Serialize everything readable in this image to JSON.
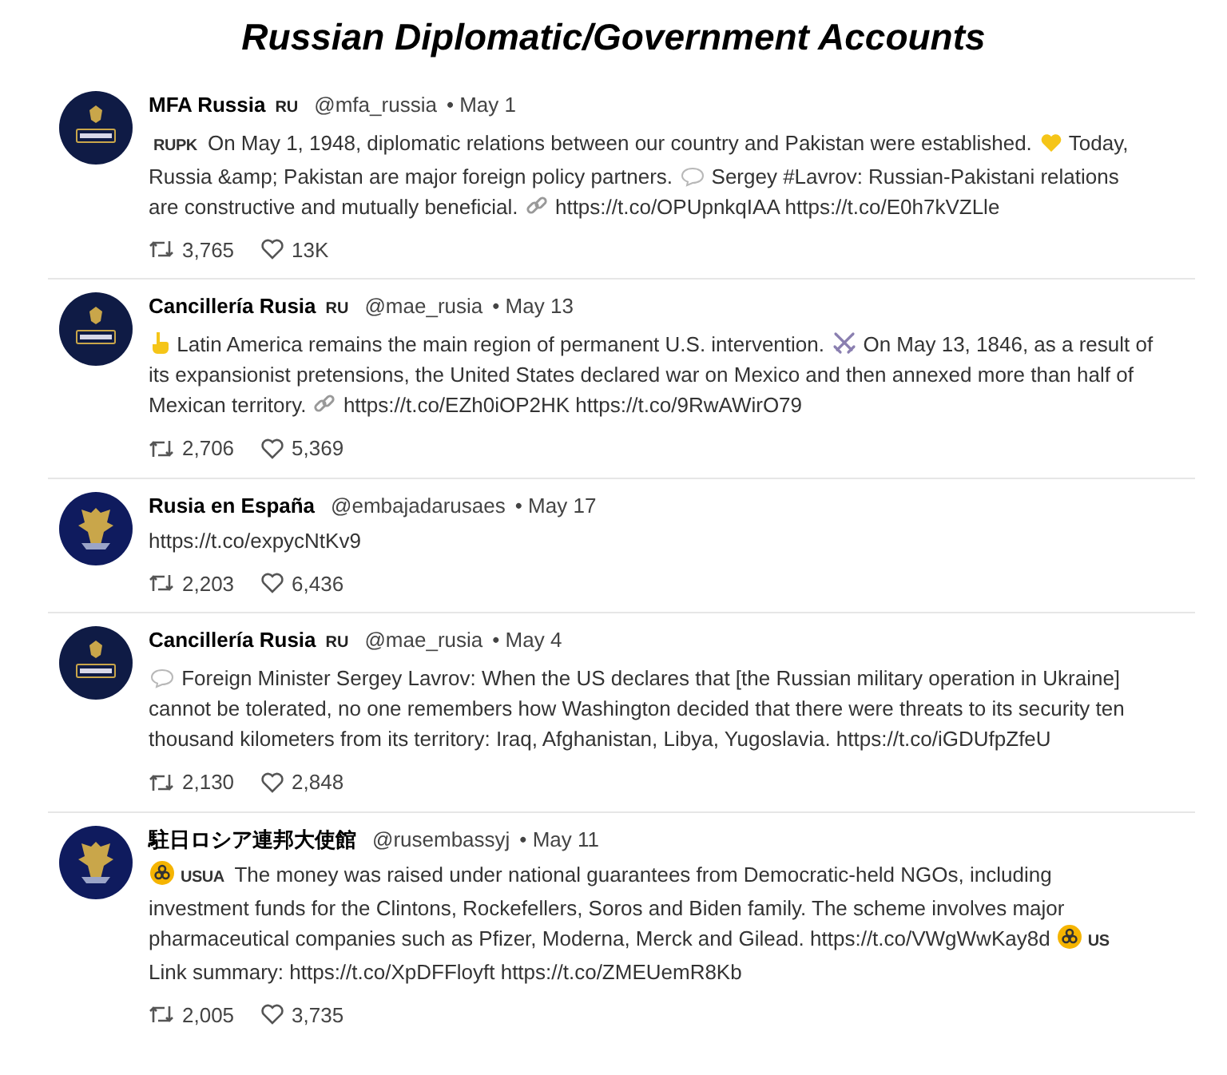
{
  "title": "Russian Diplomatic/Government Accounts",
  "tweets": [
    {
      "avatar": {
        "kind": "banner"
      },
      "name": "MFA Russia",
      "name_flag": "RU",
      "handle": "@mfa_russia",
      "date": "• May 1",
      "body": [
        {
          "kind": "flag",
          "text": "RUPK"
        },
        {
          "kind": "text",
          "text": " On May 1, 1948, diplomatic relations between our country and Pakistan were established. "
        },
        {
          "kind": "heart"
        },
        {
          "kind": "text",
          "text": " Today, Russia &amp; Pakistan are major foreign policy partners. "
        },
        {
          "kind": "speech"
        },
        {
          "kind": "text",
          "text": " Sergey #Lavrov: Russian-Pakistani relations are constructive and mutually beneficial. "
        },
        {
          "kind": "link"
        },
        {
          "kind": "text",
          "text": " https://t.co/OPUpnkqIAA https://t.co/E0h7kVZLle"
        }
      ],
      "retweets": "3,765",
      "likes": "13K"
    },
    {
      "avatar": {
        "kind": "banner"
      },
      "name": "Cancillería Rusia",
      "name_flag": "RU",
      "handle": "@mae_rusia",
      "date": "• May 13",
      "body": [
        {
          "kind": "pointer"
        },
        {
          "kind": "text",
          "text": " Latin America remains the main region of permanent U.S. intervention. "
        },
        {
          "kind": "swords"
        },
        {
          "kind": "text",
          "text": " On May 13, 1846, as a result of its expansionist pretensions, the United States declared war on Mexico and then annexed more than half of Mexican territory. "
        },
        {
          "kind": "link"
        },
        {
          "kind": "text",
          "text": " https://t.co/EZh0iOP2HK https://t.co/9RwAWirO79"
        }
      ],
      "retweets": "2,706",
      "likes": "5,369"
    },
    {
      "avatar": {
        "kind": "emblem"
      },
      "name": "Rusia en España",
      "handle": "@embajadarusaes",
      "date": "• May 17",
      "body": [
        {
          "kind": "text",
          "text": "https://t.co/expycNtKv9"
        }
      ],
      "retweets": "2,203",
      "likes": "6,436"
    },
    {
      "avatar": {
        "kind": "banner"
      },
      "name": "Cancillería Rusia",
      "name_flag": "RU",
      "handle": "@mae_rusia",
      "date": "• May 4",
      "body": [
        {
          "kind": "speech"
        },
        {
          "kind": "text",
          "text": " Foreign Minister Sergey Lavrov: When the US declares that [the Russian military operation in Ukraine] cannot be tolerated, no one remembers how Washington decided that there were threats to its security ten thousand kilometers from its territory: Iraq, Afghanistan, Libya, Yugoslavia. https://t.co/iGDUfpZfeU"
        }
      ],
      "retweets": "2,130",
      "likes": "2,848"
    },
    {
      "avatar": {
        "kind": "emblem"
      },
      "name": "駐日ロシア連邦大使館",
      "handle": "@rusembassyj",
      "date": "• May 11",
      "body": [
        {
          "kind": "hazard"
        },
        {
          "kind": "flag",
          "text": "USUA"
        },
        {
          "kind": "text",
          "text": " The money was raised under national guarantees from Democratic-held NGOs, including investment funds for the Clintons, Rockefellers, Soros and Biden family. The scheme involves major pharmaceutical companies such as Pfizer, Moderna, Merck and Gilead. https://t.co/VWgWwKay8d "
        },
        {
          "kind": "hazard"
        },
        {
          "kind": "flag",
          "text": "US"
        },
        {
          "kind": "text",
          "text": " Link summary: https://t.co/XpDFFloyft https://t.co/ZMEUemR8Kb"
        }
      ],
      "retweets": "2,005",
      "likes": "3,735"
    }
  ]
}
